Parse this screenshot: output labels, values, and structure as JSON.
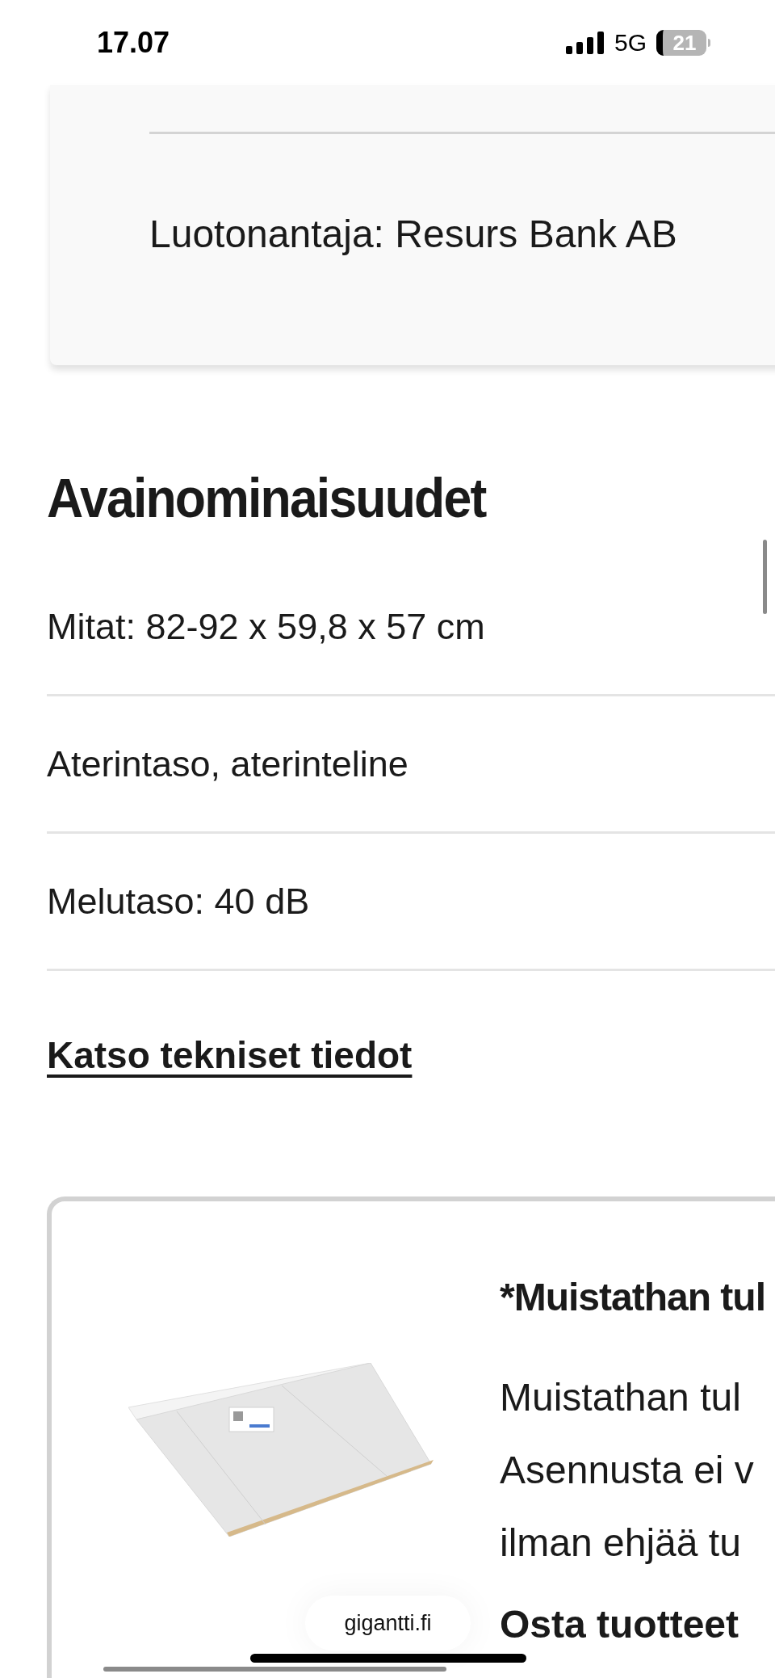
{
  "status_bar": {
    "time": "17.07",
    "network": "5G",
    "battery": "21"
  },
  "credit_card": {
    "lender": "Luotonantaja: Resurs Bank AB"
  },
  "key_features": {
    "title": "Avainominaisuudet",
    "items": [
      "Mitat: 82-92 x 59,8 x 57 cm",
      "Aterintaso, aterinteline",
      "Melutaso: 40 dB"
    ],
    "link": "Katso tekniset tiedot"
  },
  "promo": {
    "title": "*Muistathan tul",
    "lines": [
      "Muistathan tul",
      "Asennusta ei v",
      "ilman ehjää tu"
    ],
    "cta": "Osta tuotteet"
  },
  "browser": {
    "address": "gigantti.fi"
  }
}
